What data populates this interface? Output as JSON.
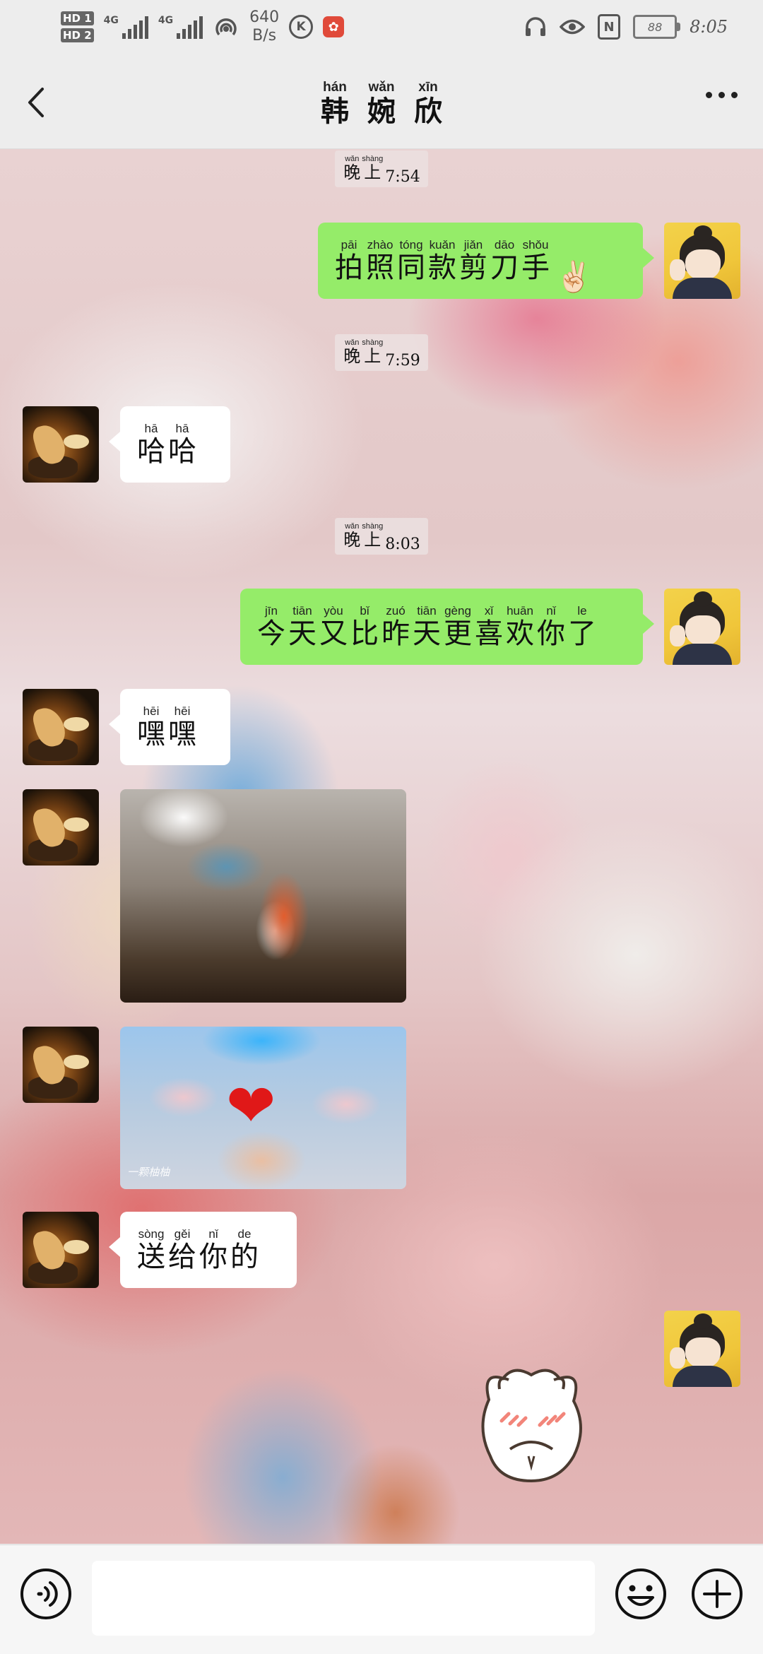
{
  "status_bar": {
    "hd1": "HD 1",
    "hd2": "HD 2",
    "net1": "4G",
    "net2": "4G",
    "speed_value": "640",
    "speed_unit": "B/s",
    "k_app": "K",
    "nfc": "N",
    "battery": "88",
    "time": "8:05"
  },
  "header": {
    "title_chars": [
      {
        "py": "hán",
        "hz": "韩"
      },
      {
        "py": "wǎn",
        "hz": "婉"
      },
      {
        "py": "xīn",
        "hz": "欣"
      }
    ],
    "icons": {
      "back": "chevron-left-icon",
      "more": "more-dots-icon"
    }
  },
  "messages": {
    "ts1": {
      "chars": [
        {
          "py": "wǎn",
          "hz": "晚"
        },
        {
          "py": "shàng",
          "hz": "上"
        }
      ],
      "time": "7:54"
    },
    "msg1": {
      "from": "me",
      "chars": [
        {
          "py": "pāi",
          "hz": "拍"
        },
        {
          "py": "zhào",
          "hz": "照"
        },
        {
          "py": "tóng",
          "hz": "同"
        },
        {
          "py": "kuǎn",
          "hz": "款"
        },
        {
          "py": "jiǎn",
          "hz": "剪"
        },
        {
          "py": "dāo",
          "hz": "刀"
        },
        {
          "py": "shǒu",
          "hz": "手"
        }
      ],
      "emoji": "✌🏻"
    },
    "ts2": {
      "chars": [
        {
          "py": "wǎn",
          "hz": "晚"
        },
        {
          "py": "shàng",
          "hz": "上"
        }
      ],
      "time": "7:59"
    },
    "msg2": {
      "from": "her",
      "chars": [
        {
          "py": "hā",
          "hz": "哈"
        },
        {
          "py": "hā",
          "hz": "哈"
        }
      ]
    },
    "ts3": {
      "chars": [
        {
          "py": "wǎn",
          "hz": "晚"
        },
        {
          "py": "shàng",
          "hz": "上"
        }
      ],
      "time": "8:03"
    },
    "msg3": {
      "from": "me",
      "chars": [
        {
          "py": "jīn",
          "hz": "今"
        },
        {
          "py": "tiān",
          "hz": "天"
        },
        {
          "py": "yòu",
          "hz": "又"
        },
        {
          "py": "bǐ",
          "hz": "比"
        },
        {
          "py": "zuó",
          "hz": "昨"
        },
        {
          "py": "tiān",
          "hz": "天"
        },
        {
          "py": "gèng",
          "hz": "更"
        },
        {
          "py": "xǐ",
          "hz": "喜"
        },
        {
          "py": "huān",
          "hz": "欢"
        },
        {
          "py": "nǐ",
          "hz": "你"
        },
        {
          "py": "le",
          "hz": "了"
        }
      ]
    },
    "msg4": {
      "from": "her",
      "chars": [
        {
          "py": "hēi",
          "hz": "嘿"
        },
        {
          "py": "hēi",
          "hz": "嘿"
        }
      ]
    },
    "photo2_watermark": "一颗柚柚",
    "msg5": {
      "from": "her",
      "chars": [
        {
          "py": "sòng",
          "hz": "送"
        },
        {
          "py": "gěi",
          "hz": "给"
        },
        {
          "py": "nǐ",
          "hz": "你"
        },
        {
          "py": "de",
          "hz": "的"
        }
      ]
    }
  },
  "input_bar": {
    "placeholder": "",
    "icons": {
      "voice": "voice-icon",
      "emoji": "emoji-icon",
      "plus": "plus-icon"
    }
  },
  "colors": {
    "my_bubble": "#95ec69",
    "her_bubble": "#ffffff",
    "header_bg": "#ededed"
  }
}
